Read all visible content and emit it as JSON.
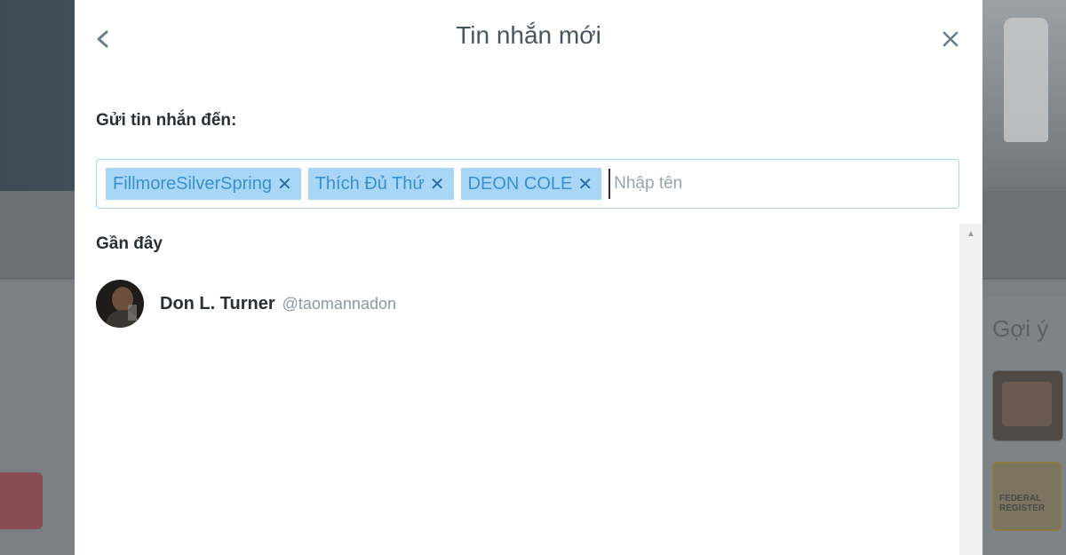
{
  "background": {
    "suggest_text": "Gợi ý",
    "thumb2_text": "FEDERAL REGISTER"
  },
  "modal": {
    "title": "Tin nhắn mới",
    "back_icon": "chevron-left-icon",
    "close_icon": "close-icon",
    "send_to_label": "Gửi tin nhắn đến:",
    "recipients": [
      {
        "name": "FillmoreSilverSpring"
      },
      {
        "name": "Thích Đủ Thứ"
      },
      {
        "name": "DEON COLE"
      }
    ],
    "input_placeholder": "Nhập tên",
    "input_value": "",
    "recent_label": "Gần đây",
    "recent_users": [
      {
        "name": "Don L. Turner",
        "handle": "@taomannadon"
      }
    ]
  },
  "colors": {
    "chip_bg": "#a7d6f7",
    "chip_text": "#3a8fd0",
    "input_border": "#a8d4f0",
    "handle_text": "#8899a6"
  }
}
